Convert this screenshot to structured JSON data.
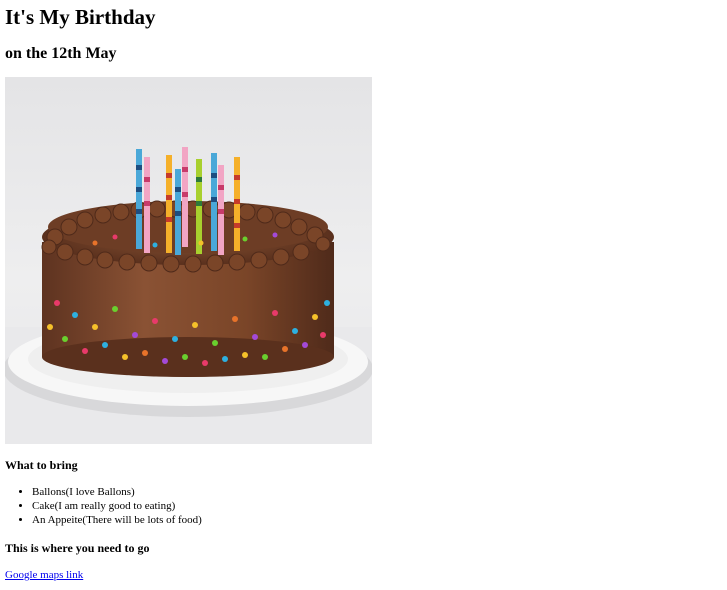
{
  "header": {
    "title": "It's My Birthday",
    "date": "on the 12th May"
  },
  "image": {
    "icon": "birthday-cake-photo"
  },
  "bring": {
    "heading": "What to bring",
    "items": [
      "Ballons(I love Ballons)",
      "Cake(I am really good to eating)",
      "An Appeite(There will be lots of food)"
    ]
  },
  "location": {
    "heading": "This is where you need to go",
    "link_text": "Google maps link"
  },
  "colors": {
    "link": "#0000ee",
    "frosting": "#7a4528",
    "plate": "#f2f2f2"
  }
}
